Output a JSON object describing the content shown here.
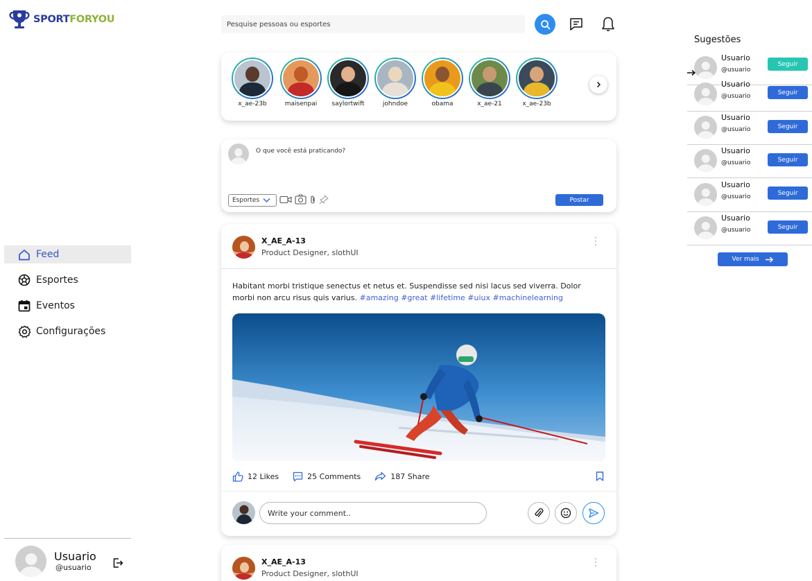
{
  "brand": {
    "part1": "SPORT",
    "part2": "FORYOU"
  },
  "nav": {
    "items": [
      {
        "label": "Feed",
        "icon": "home-icon"
      },
      {
        "label": "Esportes",
        "icon": "soccer-ball-icon"
      },
      {
        "label": "Eventos",
        "icon": "calendar-icon"
      },
      {
        "label": "Configurações",
        "icon": "gear-icon"
      }
    ]
  },
  "current_user": {
    "name": "Usuario",
    "handle": "@usuario"
  },
  "search": {
    "placeholder": "Pesquise pessoas ou esportes"
  },
  "stories": [
    {
      "name": "x_ae-23b"
    },
    {
      "name": "maisenpai"
    },
    {
      "name": "saylortwift"
    },
    {
      "name": "johndoe"
    },
    {
      "name": "obama"
    },
    {
      "name": "x_ae-21"
    },
    {
      "name": "x_ae-23b"
    }
  ],
  "composer": {
    "prompt": "O que você está praticando?",
    "category": "Esportes",
    "post_label": "Postar"
  },
  "post": {
    "author": "X_AE_A-13",
    "role": "Product Designer, slothUI",
    "text": "Habitant morbi tristique senectus et netus et. Suspendisse sed nisi lacus sed viverra. Dolor morbi non arcu risus quis varius.",
    "hashtags": "#amazing #great #lifetime #uiux #machinelearning",
    "likes": "12 Likes",
    "comments": "25 Comments",
    "shares": "187 Share",
    "comment_placeholder": "Write your comment.."
  },
  "post2": {
    "author": "X_AE_A-13",
    "role": "Product Designer, slothUI"
  },
  "suggestions": {
    "title": "Sugestões",
    "users": [
      {
        "name": "Usuario",
        "handle": "@usuario",
        "button": "Seguir",
        "highlighted": true
      },
      {
        "name": "Usuario",
        "handle": "@usuario",
        "button": "Seguir",
        "highlighted": false
      },
      {
        "name": "Usuario",
        "handle": "@usuario",
        "button": "Seguir",
        "highlighted": false
      },
      {
        "name": "Usuario",
        "handle": "@usuario",
        "button": "Seguir",
        "highlighted": false
      },
      {
        "name": "Usuario",
        "handle": "@usuario",
        "button": "Seguir",
        "highlighted": false
      },
      {
        "name": "Usuario",
        "handle": "@usuario",
        "button": "Seguir",
        "highlighted": false
      }
    ],
    "more_label": "Ver mais"
  },
  "colors": {
    "accent": "#2f6bd8",
    "accent_teal": "#27c6b2",
    "brand_blue": "#2a3c9e",
    "brand_green": "#8fb23a",
    "hashtag": "#3f5fd6"
  }
}
